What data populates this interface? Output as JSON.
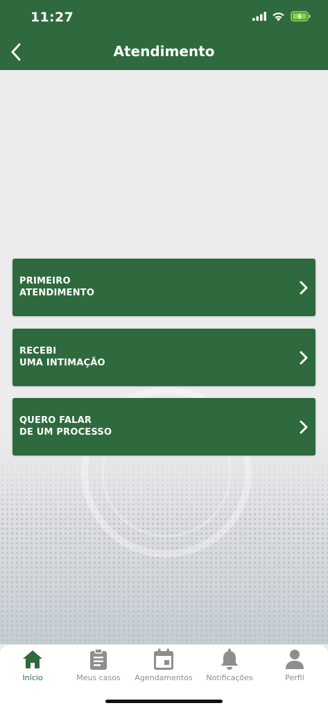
{
  "status_bar": {
    "time": "11:27"
  },
  "header": {
    "title": "Atendimento"
  },
  "menu": [
    {
      "line1": "PRIMEIRO",
      "line2": "ATENDIMENTO"
    },
    {
      "line1": "RECEBI",
      "line2": "UMA INTIMAÇÃO"
    },
    {
      "line1": "QUERO FALAR",
      "line2": "DE UM PROCESSO"
    }
  ],
  "tabs": [
    {
      "label": "Início",
      "icon": "home-icon",
      "active": true
    },
    {
      "label": "Meus casos",
      "icon": "clipboard-icon",
      "active": false
    },
    {
      "label": "Agendamentos",
      "icon": "calendar-icon",
      "active": false
    },
    {
      "label": "Notificações",
      "icon": "bell-icon",
      "active": false
    },
    {
      "label": "Perfil",
      "icon": "user-icon",
      "active": false
    }
  ],
  "colors": {
    "primary": "#2e6a3d",
    "inactive": "#8e8e8e",
    "background": "#ececec"
  }
}
